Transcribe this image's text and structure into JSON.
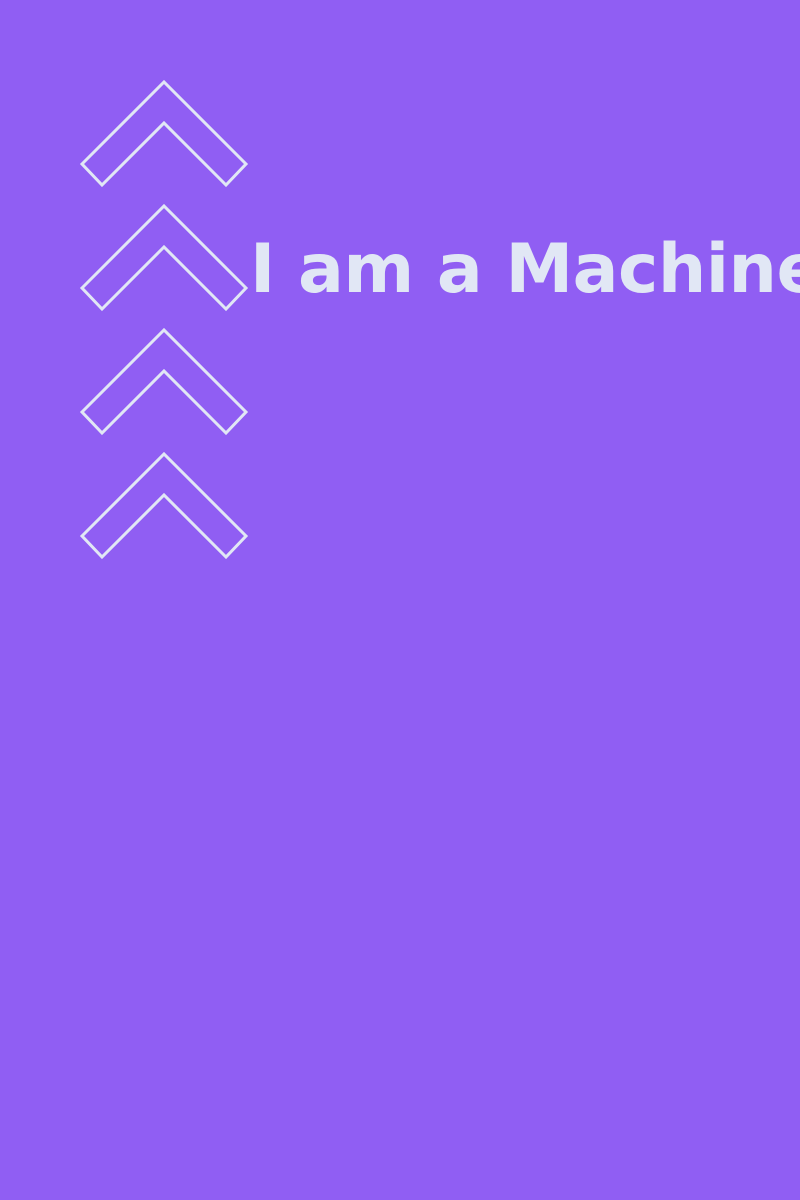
{
  "background_color": "#905EF3",
  "foreground_color": "#E1E7F5",
  "headline": {
    "text": "I am a Machine"
  },
  "decorations": {
    "icon": "double-chevron-up-outline-icon",
    "count": 4
  }
}
